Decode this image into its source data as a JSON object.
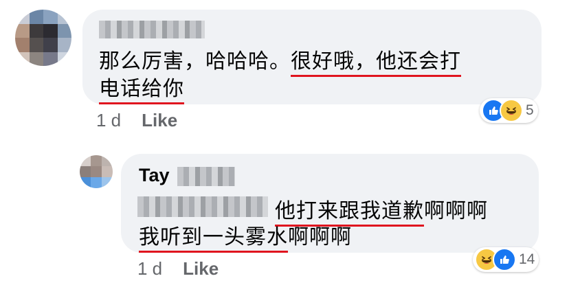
{
  "comment": {
    "text_line1_plain": "那么厉害，哈哈哈。",
    "text_line1_underlined": "很好哦，他还会打",
    "text_line2_underlined": "电话给你",
    "meta": {
      "time": "1 d",
      "like_label": "Like"
    },
    "reactions": {
      "icons": [
        "like-icon",
        "haha-icon"
      ],
      "count": "5"
    }
  },
  "reply": {
    "author": "Tay",
    "text_line1_underlined": "他打来跟我道歉",
    "text_line1_plain": "啊啊啊",
    "text_line2_underlined": "我听到一头雾水",
    "text_line2_plain": "啊啊啊",
    "meta": {
      "time": "1 d",
      "like_label": "Like"
    },
    "reactions": {
      "icons": [
        "haha-icon",
        "like-icon"
      ],
      "count": "14"
    }
  },
  "colors": {
    "bubble": "#f0f2f5",
    "underline": "#e0141e",
    "meta_text": "#65676b",
    "like_blue": "#1877f2",
    "haha_yellow": "#f7c843"
  }
}
